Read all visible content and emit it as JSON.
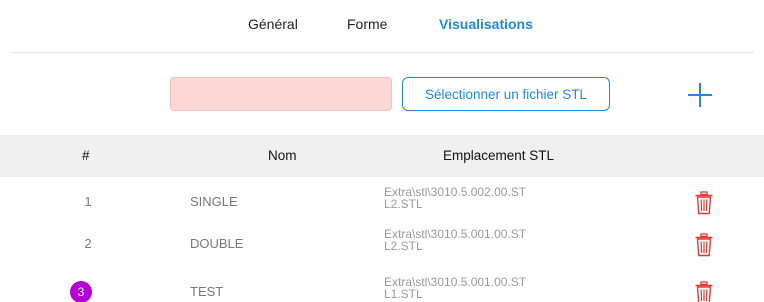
{
  "tabs": [
    {
      "label": "Général",
      "active": false
    },
    {
      "label": "Forme",
      "active": false
    },
    {
      "label": "Visualisations",
      "active": true
    }
  ],
  "toolbar": {
    "name_value": "",
    "select_stl_label": "Sélectionner un fichier STL",
    "add_icon": "plus-icon"
  },
  "table": {
    "headers": [
      "#",
      "Nom",
      "Emplacement STL"
    ],
    "rows": [
      {
        "num": "1",
        "name": "SINGLE",
        "location": "Extra\\stl\\3010.5.002.00.ST\nL2.STL",
        "highlight": false
      },
      {
        "num": "2",
        "name": "DOUBLE",
        "location": "Extra\\stl\\3010.5.001.00.ST\nL2.STL",
        "highlight": false
      },
      {
        "num": "3",
        "name": "TEST",
        "location": "Extra\\stl\\3010.5.001.00.ST\nL1.STL",
        "highlight": true
      }
    ],
    "delete_icon": "trash-icon"
  },
  "colors": {
    "accent": "#1e88e5",
    "input_error_bg": "#fbd7d5",
    "delete": "#e53935",
    "badge": "#b400d6"
  }
}
